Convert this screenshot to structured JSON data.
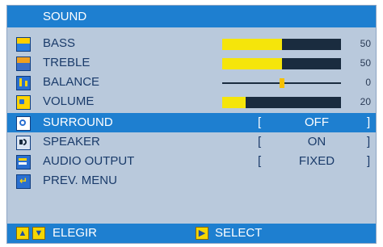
{
  "header": {
    "title": "SOUND"
  },
  "menu": {
    "bass": {
      "label": "BASS",
      "value": "50",
      "level": 0.5
    },
    "treble": {
      "label": "TREBLE",
      "value": "50",
      "level": 0.5
    },
    "balance": {
      "label": "BALANCE",
      "value": "0",
      "level": 0.5
    },
    "volume": {
      "label": "VOLUME",
      "value": "20",
      "level": 0.2
    },
    "surround": {
      "label": "SURROUND",
      "option": "OFF",
      "open": "[",
      "close": "]",
      "selected": true
    },
    "speaker": {
      "label": "SPEAKER",
      "option": "ON",
      "open": "[",
      "close": "]"
    },
    "audio_output": {
      "label": "AUDIO OUTPUT",
      "option": "FIXED",
      "open": "[",
      "close": "]"
    },
    "prev_menu": {
      "label": "PREV. MENU"
    }
  },
  "footer": {
    "left_label": "ELEGIR",
    "right_label": "SELECT"
  },
  "colors": {
    "panel": "#b9c9dc",
    "highlight": "#1e7fd0",
    "bar_fill": "#f5e50a",
    "bar_track": "#1a2c3f"
  },
  "icons": {
    "bass": "bass-icon",
    "treble": "treble-icon",
    "balance": "balance-icon",
    "volume": "volume-icon",
    "surround": "surround-icon",
    "speaker": "speaker-icon",
    "audio_output": "audio-output-icon",
    "prev_menu": "return-icon",
    "up": "arrow-up-icon",
    "down": "arrow-down-icon",
    "select": "arrow-right-icon"
  }
}
